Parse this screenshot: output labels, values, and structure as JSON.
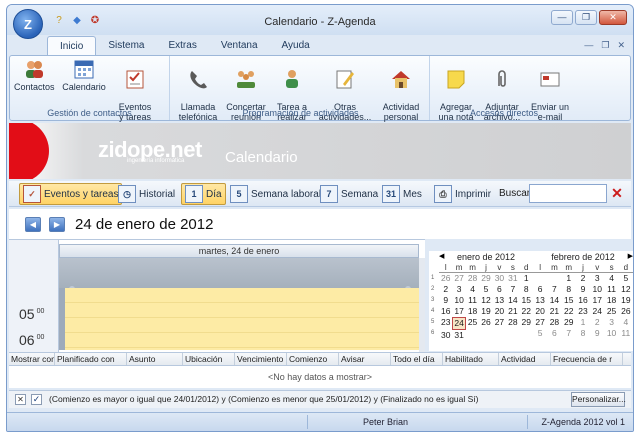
{
  "window": {
    "title": "Calendario - Z-Agenda",
    "app_orb": "Z"
  },
  "menu": {
    "tabs": [
      "Inicio",
      "Sistema",
      "Extras",
      "Ventana",
      "Ayuda"
    ],
    "active_tab": "Inicio"
  },
  "ribbon": {
    "groups": [
      {
        "label": "Gestión de contactos",
        "buttons": [
          "Contactos",
          "Calendario",
          "Eventos\ny tareas"
        ]
      },
      {
        "label": "Programación de actividades",
        "buttons": [
          "Llamada\ntelefónica",
          "Concertar\nreunión",
          "Tarea a\nrealizar",
          "Otras\nactividades...",
          "Actividad\npersonal"
        ]
      },
      {
        "label": "Accesos directos",
        "buttons": [
          "Agregar\nuna nota",
          "Adjuntar\narchivo...",
          "Enviar un\ne-mail"
        ]
      }
    ]
  },
  "banner": {
    "brand": "zidope.net",
    "brand_sub": "ingeniería informática",
    "section": "Calendario"
  },
  "toolbar": {
    "eventos": "Eventos y tareas",
    "historial": "Historial",
    "dia": "Día",
    "semana_laboral": "Semana laboral",
    "semana": "Semana",
    "mes": "Mes",
    "imprimir": "Imprimir",
    "buscar_label": "Buscar:",
    "buscar_value": "",
    "icon_dia": "1",
    "icon_semana_laboral": "5",
    "icon_semana": "7",
    "icon_mes": "31"
  },
  "datenav": {
    "title": "24 de enero de 2012"
  },
  "dayview": {
    "header": "martes, 24 de enero",
    "times": [
      {
        "hour": "05",
        "min": "00"
      },
      {
        "hour": "06",
        "min": "00"
      }
    ]
  },
  "minicals": {
    "dow": [
      "l",
      "m",
      "m",
      "j",
      "v",
      "s",
      "d"
    ],
    "months": [
      {
        "title": "enero de 2012",
        "weeks": [
          "1",
          "2",
          "3",
          "4",
          "5",
          "6"
        ],
        "days": [
          [
            "26",
            "o"
          ],
          [
            "27",
            "o"
          ],
          [
            "28",
            "o"
          ],
          [
            "29",
            "o"
          ],
          [
            "30",
            "o"
          ],
          [
            "31",
            "o"
          ],
          [
            "1",
            ""
          ],
          [
            "2",
            ""
          ],
          [
            "3",
            ""
          ],
          [
            "4",
            ""
          ],
          [
            "5",
            ""
          ],
          [
            "6",
            ""
          ],
          [
            "7",
            ""
          ],
          [
            "8",
            ""
          ],
          [
            "9",
            ""
          ],
          [
            "10",
            ""
          ],
          [
            "11",
            ""
          ],
          [
            "12",
            ""
          ],
          [
            "13",
            ""
          ],
          [
            "14",
            ""
          ],
          [
            "15",
            ""
          ],
          [
            "16",
            ""
          ],
          [
            "17",
            ""
          ],
          [
            "18",
            ""
          ],
          [
            "19",
            ""
          ],
          [
            "20",
            ""
          ],
          [
            "21",
            ""
          ],
          [
            "22",
            ""
          ],
          [
            "23",
            ""
          ],
          [
            "24",
            "sel"
          ],
          [
            "25",
            ""
          ],
          [
            "26",
            ""
          ],
          [
            "27",
            ""
          ],
          [
            "28",
            ""
          ],
          [
            "29",
            ""
          ],
          [
            "30",
            ""
          ],
          [
            "31",
            ""
          ]
        ]
      },
      {
        "title": "febrero de 2012",
        "days": [
          [
            "",
            ""
          ],
          [
            "",
            ""
          ],
          [
            "1",
            ""
          ],
          [
            "2",
            ""
          ],
          [
            "3",
            ""
          ],
          [
            "4",
            ""
          ],
          [
            "5",
            ""
          ],
          [
            "6",
            ""
          ],
          [
            "7",
            ""
          ],
          [
            "8",
            ""
          ],
          [
            "9",
            ""
          ],
          [
            "10",
            ""
          ],
          [
            "11",
            ""
          ],
          [
            "12",
            ""
          ],
          [
            "13",
            ""
          ],
          [
            "14",
            ""
          ],
          [
            "15",
            ""
          ],
          [
            "16",
            ""
          ],
          [
            "17",
            ""
          ],
          [
            "18",
            ""
          ],
          [
            "19",
            ""
          ],
          [
            "20",
            ""
          ],
          [
            "21",
            ""
          ],
          [
            "22",
            ""
          ],
          [
            "23",
            ""
          ],
          [
            "24",
            ""
          ],
          [
            "25",
            ""
          ],
          [
            "26",
            ""
          ],
          [
            "27",
            ""
          ],
          [
            "28",
            ""
          ],
          [
            "29",
            ""
          ],
          [
            "1",
            "o"
          ],
          [
            "2",
            "o"
          ],
          [
            "3",
            "o"
          ],
          [
            "4",
            "o"
          ],
          [
            "5",
            "o"
          ],
          [
            "6",
            "o"
          ],
          [
            "7",
            "o"
          ],
          [
            "8",
            "o"
          ],
          [
            "9",
            "o"
          ],
          [
            "10",
            "o"
          ],
          [
            "11",
            "o"
          ]
        ]
      }
    ]
  },
  "list": {
    "columns": [
      "Mostrar como",
      "Planificado con",
      "Asunto",
      "Ubicación",
      "Vencimiento",
      "Comienzo",
      "Avisar",
      "Todo el día",
      "Habilitado",
      "Actividad",
      "Frecuencia de r"
    ],
    "empty": "<No hay datos a mostrar>"
  },
  "filter": {
    "text": "(Comienzo es mayor o igual que 24/01/2012) y (Comienzo es menor que 25/01/2012) y (Finalizado no es igual Sí)",
    "customize": "Personalizar..."
  },
  "status": {
    "user": "Peter Brian",
    "version": "Z-Agenda 2012 vol 1"
  },
  "colors": {
    "accent": "#2a63b8",
    "brand_red": "#e20d17",
    "selected_view": "#ffd365",
    "day_slots": "#fdeba5"
  }
}
